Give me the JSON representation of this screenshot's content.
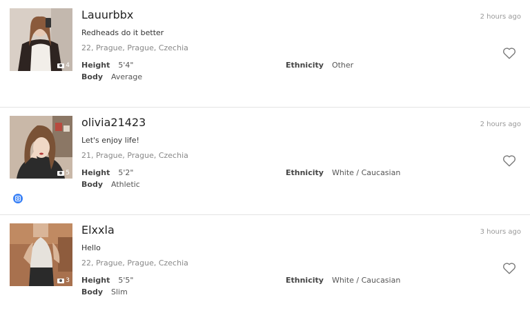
{
  "profiles": [
    {
      "username": "Lauurbbx",
      "tagline": "Redheads do it better",
      "location": "22, Prague, Prague, Czechia",
      "photo_count": "4",
      "time": "2 hours ago",
      "height_label": "Height",
      "height": "5'4\"",
      "body_label": "Body",
      "body": "Average",
      "ethnicity_label": "Ethnicity",
      "ethnicity": "Other",
      "photo_colors": [
        "#d9cfc6",
        "#f2eee9",
        "#3a2c28"
      ]
    },
    {
      "username": "olivia21423",
      "tagline": "Let's enjoy life!",
      "location": "21, Prague, Prague, Czechia",
      "photo_count": "5",
      "time": "2 hours ago",
      "height_label": "Height",
      "height": "5'2\"",
      "body_label": "Body",
      "body": "Athletic",
      "ethnicity_label": "Ethnicity",
      "ethnicity": "White / Caucasian",
      "photo_colors": [
        "#c9b8a8",
        "#e8d5c4",
        "#6b4a36"
      ]
    },
    {
      "username": "Elxxla",
      "tagline": "Hello",
      "location": "22, Prague, Prague, Czechia",
      "photo_count": "3",
      "time": "3 hours ago",
      "height_label": "Height",
      "height": "5'5\"",
      "body_label": "Body",
      "body": "Slim",
      "ethnicity_label": "Ethnicity",
      "ethnicity": "White / Caucasian",
      "photo_colors": [
        "#a8714e",
        "#e6e2dc",
        "#2a2a2a"
      ]
    }
  ],
  "instagram_badge_color": "#3b82f6"
}
